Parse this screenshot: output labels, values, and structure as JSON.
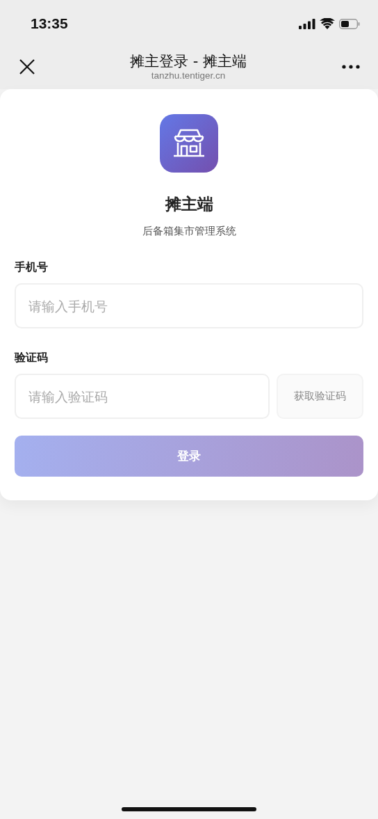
{
  "status_bar": {
    "time": "13:35"
  },
  "nav_bar": {
    "title": "摊主登录 - 摊主端",
    "url": "tanzhu.tentiger.cn"
  },
  "app": {
    "name": "摊主端",
    "subtitle": "后备箱集市管理系统"
  },
  "form": {
    "fields": [
      {
        "label": "手机号",
        "placeholder": "请输入手机号"
      },
      {
        "label": "验证码",
        "placeholder": "请输入验证码",
        "button": "获取验证码"
      }
    ],
    "submit": {
      "label": "登录",
      "disabled": true
    }
  }
}
